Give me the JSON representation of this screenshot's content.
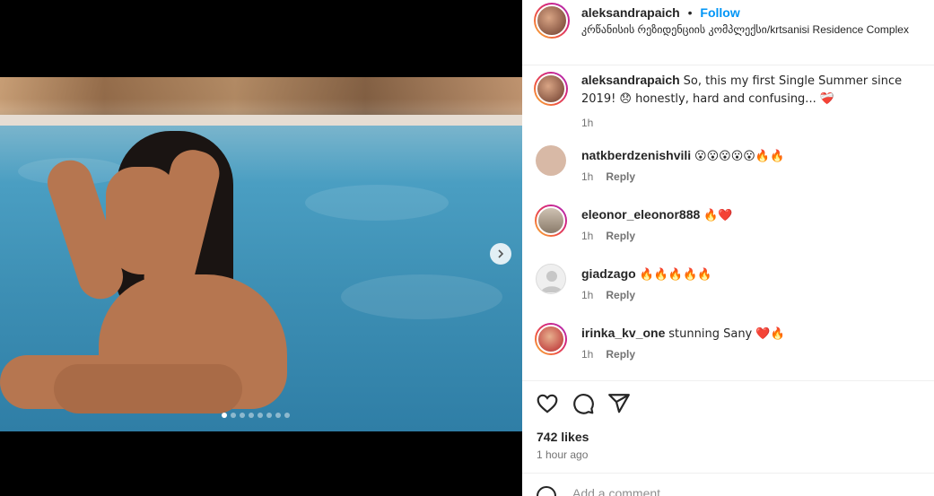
{
  "post": {
    "username": "aleksandrapaich",
    "follow_label": "Follow",
    "separator": "•",
    "location": "კრწანისის რეზიდენციის კომპლექსი/krtsanisi Residence Complex",
    "caption": "So, this my first Single Summer since 2019! 😞 honestly, hard and confusing... ❤️‍🩹",
    "caption_time": "1h",
    "likes": "742 likes",
    "posted_ago": "1 hour ago",
    "carousel": {
      "total": 8,
      "active_index": 0
    }
  },
  "comments": [
    {
      "username": "natkberdzenishvili",
      "text": "😮😮😮😮😮🔥🔥",
      "time": "1h",
      "reply_label": "Reply",
      "avatar_color": "#d8b9a6"
    },
    {
      "username": "eleonor_eleonor888",
      "text": "🔥❤️",
      "time": "1h",
      "reply_label": "Reply",
      "avatar_color": "#b8a694"
    },
    {
      "username": "giadzago",
      "text": "🔥🔥🔥🔥🔥",
      "time": "1h",
      "reply_label": "Reply",
      "avatar_color": "#dbdbdb"
    },
    {
      "username": "irinka_kv_one",
      "text": "stunning Sany ❤️🔥",
      "time": "1h",
      "reply_label": "Reply",
      "avatar_color": "#c53a3a"
    }
  ],
  "composer": {
    "placeholder": "Add a comment..."
  },
  "colors": {
    "accent": "#0095f6",
    "meta": "#737373",
    "text": "#262626"
  }
}
